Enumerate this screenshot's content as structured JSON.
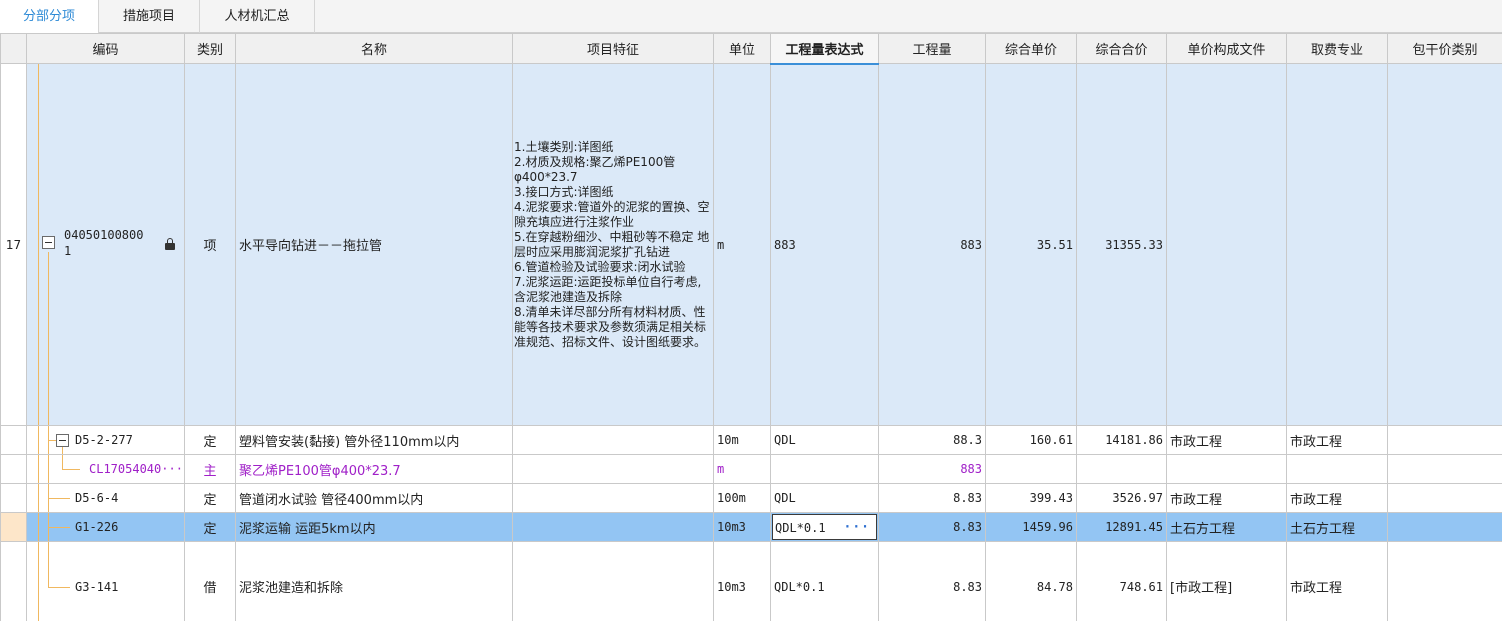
{
  "tabs": [
    {
      "label": "分部分项"
    },
    {
      "label": "措施项目"
    },
    {
      "label": "人材机汇总"
    }
  ],
  "columns": [
    "编码",
    "类别",
    "名称",
    "项目特征",
    "单位",
    "工程量表达式",
    "工程量",
    "综合单价",
    "综合合价",
    "单价构成文件",
    "取费专业",
    "包干价类别"
  ],
  "rows": [
    {
      "rownum": "17",
      "code_line1": "04050100800",
      "code_line2": "1",
      "type": "项",
      "name": "水平导向钻进－－拖拉管",
      "features": [
        "1.土壤类别:详图纸",
        "2.材质及规格:聚乙烯PE100管φ400*23.7",
        "3.接口方式:详图纸",
        "4.泥浆要求:管道外的泥浆的置换、空隙充填应进行注浆作业",
        "5.在穿越粉细沙、中粗砂等不稳定 地层时应采用膨润泥浆扩孔钻进",
        "6.管道检验及试验要求:闭水试验",
        "7.泥浆运距:运距投标单位自行考虑,含泥浆池建造及拆除",
        "8.清单未详尽部分所有材料材质、性能等各技术要求及参数须满足相关标准规范、招标文件、设计图纸要求。"
      ],
      "unit": "m",
      "expr": "883",
      "qty": "883",
      "unit_price": "35.51",
      "total": "31355.33",
      "price_file": "",
      "fee_type": ""
    },
    {
      "code": "D5-2-277",
      "type": "定",
      "name": "塑料管安装(黏接) 管外径110mm以内",
      "unit": "10m",
      "expr": "QDL",
      "qty": "88.3",
      "unit_price": "160.61",
      "total": "14181.86",
      "price_file": "市政工程",
      "fee_type": "市政工程"
    },
    {
      "code": "CL17054040···",
      "type": "主",
      "name": "聚乙烯PE100管φ400*23.7",
      "unit": "m",
      "expr": "",
      "qty": "883",
      "unit_price": "",
      "total": "",
      "price_file": "",
      "fee_type": ""
    },
    {
      "code": "D5-6-4",
      "type": "定",
      "name": "管道闭水试验 管径400mm以内",
      "unit": "100m",
      "expr": "QDL",
      "qty": "8.83",
      "unit_price": "399.43",
      "total": "3526.97",
      "price_file": "市政工程",
      "fee_type": "市政工程"
    },
    {
      "code": "G1-226",
      "type": "定",
      "name": "泥浆运输 运距5km以内",
      "unit": "10m3",
      "expr": "QDL*0.1",
      "qty": "8.83",
      "unit_price": "1459.96",
      "total": "12891.45",
      "price_file": "土石方工程",
      "fee_type": "土石方工程"
    },
    {
      "code": "G3-141",
      "type": "借",
      "name": "泥浆池建造和拆除",
      "unit": "10m3",
      "expr": "QDL*0.1",
      "qty": "8.83",
      "unit_price": "84.78",
      "total": "748.61",
      "price_file": "[市政工程]",
      "fee_type": "市政工程"
    }
  ],
  "colors": {
    "selected_row": "#93c5f3",
    "parent_row": "#dbe9f8",
    "main_material_text": "#a020c8",
    "tree_line": "#f0b860",
    "active_tab_text": "#2d8ad6"
  },
  "icons": {
    "lock": "lock-icon",
    "expander": "collapse-minus-icon",
    "edit_more": "ellipsis-icon"
  }
}
